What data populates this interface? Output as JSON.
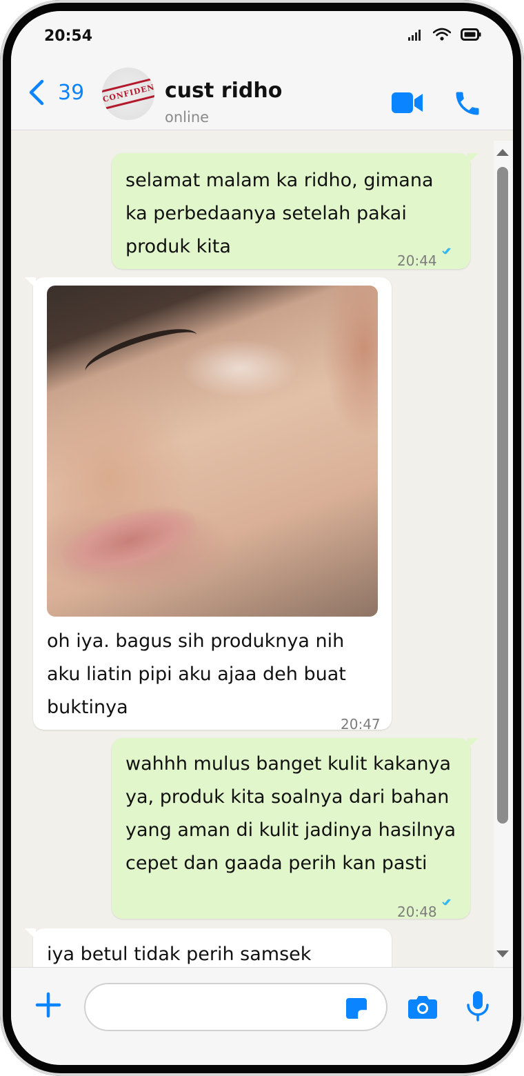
{
  "status_bar": {
    "time": "20:54"
  },
  "header": {
    "back_count": "39",
    "avatar_stamp": "CONFIDENTIAL",
    "contact_name": "cust ridho",
    "contact_status": "online"
  },
  "messages": [
    {
      "direction": "outgoing",
      "text": "selamat malam ka ridho, gimana ka perbedaanya setelah pakai produk kita",
      "time": "20:44",
      "read": true
    },
    {
      "direction": "incoming",
      "has_image": true,
      "text": "oh iya. bagus sih produknya nih aku liatin pipi aku ajaa deh buat buktinya",
      "time": "20:47"
    },
    {
      "direction": "outgoing",
      "text": "wahhh mulus banget kulit kakanya ya, produk kita soalnya dari bahan yang aman di kulit jadinya hasilnya cepet dan gaada perih kan pasti",
      "time": "20:48",
      "read": true
    },
    {
      "direction": "incoming",
      "text": "iya betul tidak perih samsek"
    }
  ],
  "input": {
    "placeholder": ""
  },
  "colors": {
    "accent": "#0a84ff",
    "outgoing_bubble": "#e2f6cb",
    "incoming_bubble": "#ffffff",
    "chat_background": "#f2f0ea",
    "read_ticks": "#34b7f1"
  },
  "icons": [
    "back-chevron-icon",
    "video-call-icon",
    "phone-call-icon",
    "plus-icon",
    "sticker-icon",
    "camera-icon",
    "microphone-icon",
    "signal-icon",
    "wifi-icon",
    "battery-icon"
  ]
}
